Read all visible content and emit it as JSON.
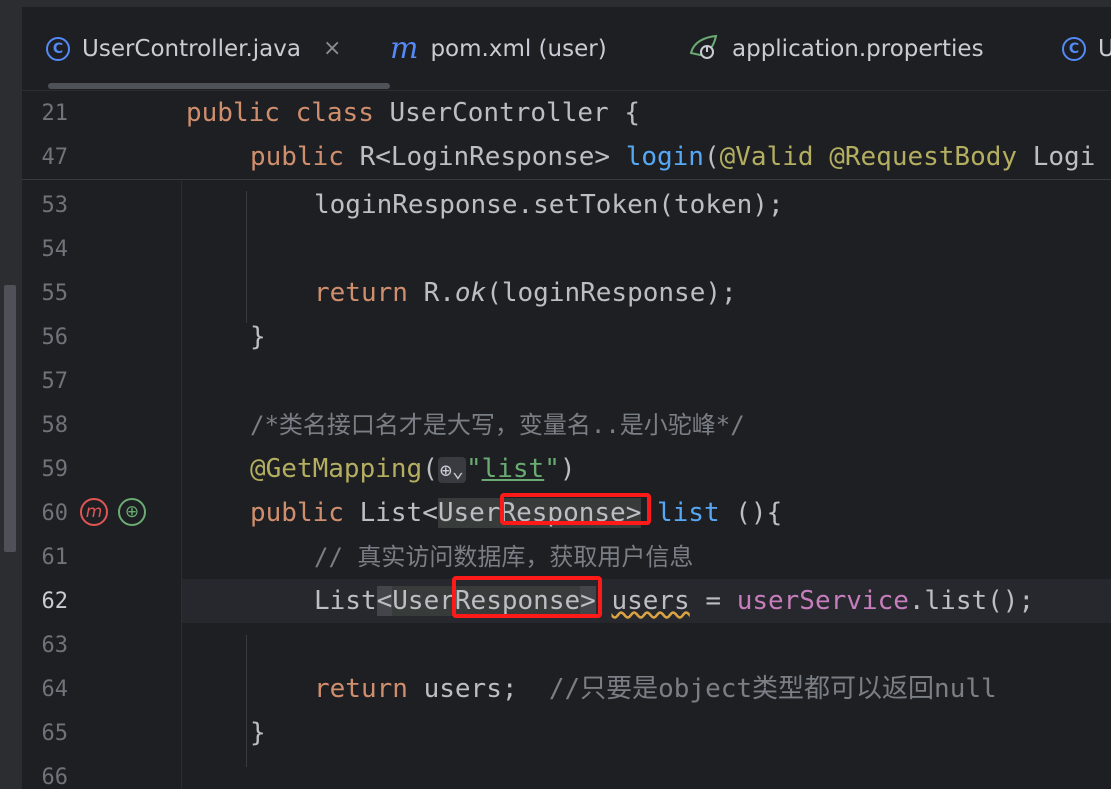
{
  "tabs": [
    {
      "icon": "class-icon",
      "icon_glyph": "C",
      "label": "UserController.java",
      "active": true,
      "close": "×"
    },
    {
      "icon": "maven-icon",
      "icon_glyph": "m",
      "label": "pom.xml (user)"
    },
    {
      "icon": "spring-properties-icon",
      "icon_glyph": "⚙",
      "label": "application.properties"
    },
    {
      "icon": "class-icon",
      "icon_glyph": "C",
      "label": "U"
    }
  ],
  "editor": {
    "current_line": "62",
    "gutter_icons": {
      "mybatis": "m",
      "spring_web": "⊕"
    },
    "lines": [
      {
        "n": "21",
        "t": {
          "a": "public",
          "b": " ",
          "c": "class",
          "d": " UserController {"
        }
      },
      {
        "n": "47",
        "t": {
          "a": "public",
          "b": " R<LoginResponse> ",
          "c": "login",
          "d": "(",
          "e": "@Valid",
          "f": " ",
          "g": "@RequestBody",
          "h": " Logi"
        }
      },
      {
        "n": "53",
        "t": {
          "a": "loginResponse.setToken(token);"
        }
      },
      {
        "n": "54",
        "t": {}
      },
      {
        "n": "55",
        "t": {
          "a": "return",
          "b": " R.",
          "c": "ok",
          "d": "(loginResponse);"
        }
      },
      {
        "n": "56",
        "t": {
          "a": "}"
        }
      },
      {
        "n": "57",
        "t": {}
      },
      {
        "n": "58",
        "t": {
          "a": "/*类名接口名才是大写，变量名..是小驼峰*/"
        }
      },
      {
        "n": "59",
        "t": {
          "a": "@GetMapping",
          "b": "(",
          "c": "⊕⌄",
          "d": "\"",
          "e": "list",
          "f": "\"",
          "g": ")"
        }
      },
      {
        "n": "60",
        "t": {
          "a": "public",
          "b": " List<",
          "c": "UserResponse",
          "d": ">",
          "e": " ",
          "f": "list",
          "g": " (){"
        }
      },
      {
        "n": "61",
        "t": {
          "a": "// 真实访问数据库，获取用户信息"
        }
      },
      {
        "n": "62",
        "t": {
          "a": "List",
          "b": "<",
          "c": "UserResponse",
          "d": ">",
          "e": " ",
          "f": "users",
          "g": " = ",
          "h": "userService",
          "i": ".list();"
        }
      },
      {
        "n": "63",
        "t": {}
      },
      {
        "n": "64",
        "t": {
          "a": "return",
          "b": " users;  ",
          "c": "//只要是object类型都可以返回null"
        }
      },
      {
        "n": "65",
        "t": {
          "a": "}"
        }
      },
      {
        "n": "66",
        "t": {}
      }
    ]
  },
  "colors": {
    "background": "#1e1f22",
    "keyword": "#cf8e6d",
    "annotation": "#b3ae60",
    "function": "#56a8f5",
    "string": "#6aab73",
    "comment": "#7a7e85",
    "field": "#c77dbb",
    "highlight_box": "#ff1a1a"
  }
}
